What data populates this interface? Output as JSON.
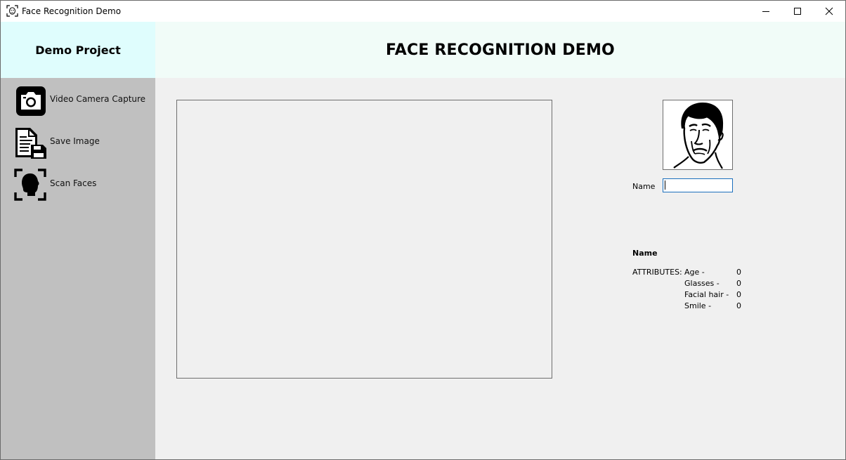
{
  "window": {
    "title": "Face Recognition Demo",
    "icon": "face-scan-icon",
    "controls": [
      "minimize-icon",
      "maximize-icon",
      "close-icon"
    ]
  },
  "header": {
    "project": "Demo Project",
    "title": "FACE RECOGNITION DEMO"
  },
  "sidebar": {
    "items": [
      {
        "label": "Video Camera Capture",
        "icon": "camera-icon"
      },
      {
        "label": "Save Image",
        "icon": "save-document-icon"
      },
      {
        "label": "Scan Faces",
        "icon": "face-scan-icon"
      }
    ]
  },
  "form": {
    "name_label": "Name",
    "name_value": ""
  },
  "result": {
    "name": "Name",
    "attributes_label": "ATTRIBUTES:",
    "attributes": [
      {
        "label": "Age -",
        "value": "0"
      },
      {
        "label": "Glasses -",
        "value": "0"
      },
      {
        "label": "Facial hair -",
        "value": "0"
      },
      {
        "label": "Smile -",
        "value": "0"
      }
    ]
  },
  "colors": {
    "header_left_bg": "#dffdfd",
    "header_right_bg": "#f1fcf8",
    "sidebar_bg": "#c0c0c0",
    "content_bg": "#f0f0f0",
    "input_border": "#1b6fbd"
  }
}
